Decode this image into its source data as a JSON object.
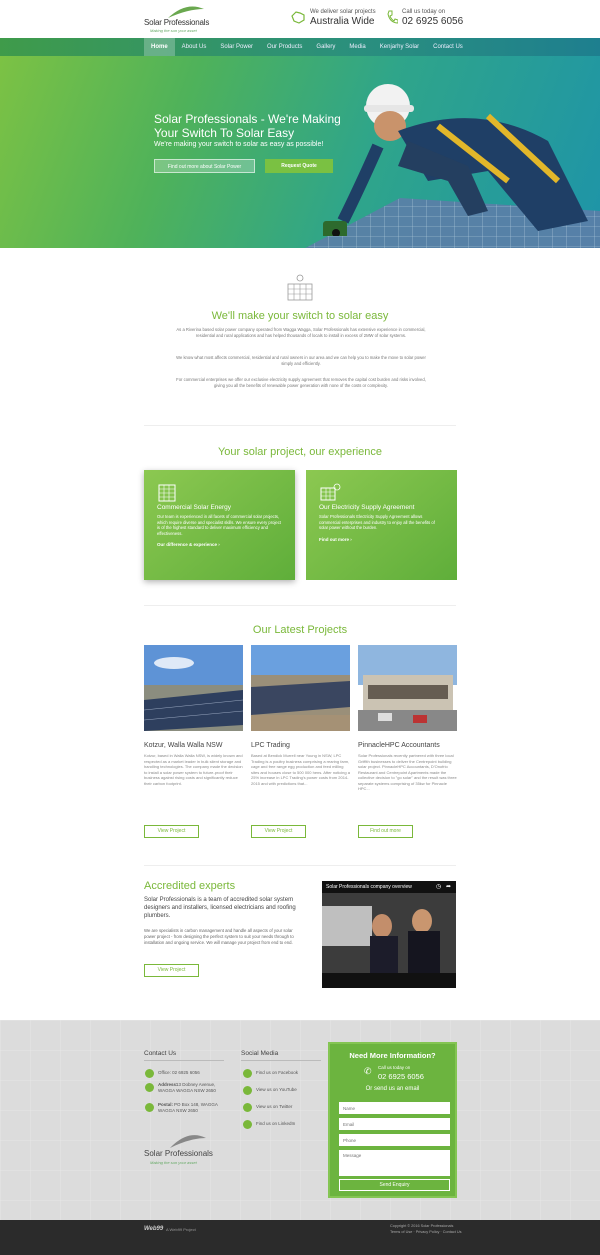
{
  "header": {
    "logo_text": "Solar Professionals",
    "logo_tagline": "Making the sun your asset",
    "deliver_label": "We deliver solar projects",
    "deliver_value": "Australia Wide",
    "call_label": "Call us today on",
    "call_value": "02 6925 6056"
  },
  "nav": [
    "Home",
    "About Us",
    "Solar Power",
    "Our Products",
    "Gallery",
    "Media",
    "Kenjarhy Solar",
    "Contact Us"
  ],
  "hero": {
    "title": "Solar Professionals - We're Making Your Switch To Solar Easy",
    "subtitle": "We're making your switch to solar as easy as possible!",
    "btn_find": "Find out more about Solar Power",
    "btn_quote": "Request Quote"
  },
  "intro": {
    "title": "We'll make your switch to solar easy",
    "p1": "As a Riverina based solar power company operated from Wagga Wagga, Solar Professionals has extensive experience in commercial, residential and rural applications and has helped thousands of locals to install in excess of 2MW of solar systems.",
    "p2": "We know what most affects commercial, residential and rural owners in our area and we can help you to make the move to solar power simply and efficiently.",
    "p3": "For commercial enterprises we offer our exclusive electricity supply agreement that removes the capital cost burden and risks involved, giving you all the benefits of renewable power generation with none of the costs or complexity."
  },
  "experience": {
    "title": "Your solar project, our experience",
    "cards": [
      {
        "title": "Commercial Solar Energy",
        "text": "Our team is experienced in all facets of commercial solar projects, which require diverse and specialist skills. We ensure every project is of the highest standard to deliver maximum efficiency and effectiveness.",
        "link": "Our difference & experience ›"
      },
      {
        "title": "Our Electricity Supply Agreement",
        "text": "Solar Professionals Electricity Supply Agreement allows commercial enterprises and industry to enjoy all the benefits of solar power without the burden.",
        "link": "Find out more ›"
      }
    ]
  },
  "projects": {
    "title": "Our Latest Projects",
    "items": [
      {
        "title": "Kotzur, Walla Walla NSW",
        "text": "Kotzur, based in Walla Walla NSW, is widely known and respected as a market leader in bulk silent storage and handling technologies. The company made the decision to install a solar power system to future-proof their business against rising costs and significantly reduce their carbon footprint.",
        "btn": "View Project"
      },
      {
        "title": "LPC Trading",
        "text": "Based at Bendick Murrell near Young in NSW, LPC Trading is a poultry business comprising a rearing farm, cage and free range egg production and feed milling sites and houses close to 500 000 hens. After noticing a 25% increase in LPC Trading's power costs from 2014-2015 and with predictions that...",
        "btn": "View Project"
      },
      {
        "title": "PinnacleHPC Accountants",
        "text": "Solar Professionals recently partnered with three local Griffith businesses to deliver the Centrepoint building solar project. PinnacleHPC Accountants, D'Onofrio Restaurant and Centrepoint Apartments made the collective decision to \"go solar\" and the result was three separate systems comprising of 35kw for Pinnacle HPC...",
        "btn": "Find out more"
      }
    ]
  },
  "accredited": {
    "title": "Accredited experts",
    "lead": "Solar Professionals is a team of accredited solar system designers and installers, licensed electricians and roofing plumbers.",
    "body": "We are specialists in carbon management and handle all aspects of your solar power project - from designing the perfect system to suit your needs through to installation and ongoing service. We will manage your project from end to end.",
    "btn": "View Project",
    "video_title": "Solar Professionals company overview"
  },
  "footer": {
    "contact_title": "Contact Us",
    "office": "Office: 02 6925 6056",
    "address_label": "Address:",
    "address": "13 Dobney Avenue, WAGGA WAGGA NSW 2650",
    "postal_label": "Postal:",
    "postal": "PO Box 148, WAGGA WAGGA NSW 2650",
    "social_title": "Social Media",
    "social": [
      "Find us on Facebook",
      "View us on YouTube",
      "View us on Twitter",
      "Find us on LinkedIn"
    ],
    "form_title": "Need More Information?",
    "form_call": "Call us today on",
    "form_phone": "02 6925 6056",
    "form_email": "Or send us an email",
    "ph_name": "Name",
    "ph_email": "Email",
    "ph_phone": "Phone",
    "ph_message": "Message",
    "send": "Send Enquiry"
  },
  "bottom": {
    "brand": "Web99",
    "brand_sub": "A Web99 Project",
    "copy": "Copyright © 2016 Solar Professionals",
    "links": "Terms of Use · Privacy Policy · Contact Us"
  },
  "colors": {
    "accent": "#7ab83a",
    "nav": "#2a8f7e",
    "footer_bar": "#2b2b2b"
  }
}
